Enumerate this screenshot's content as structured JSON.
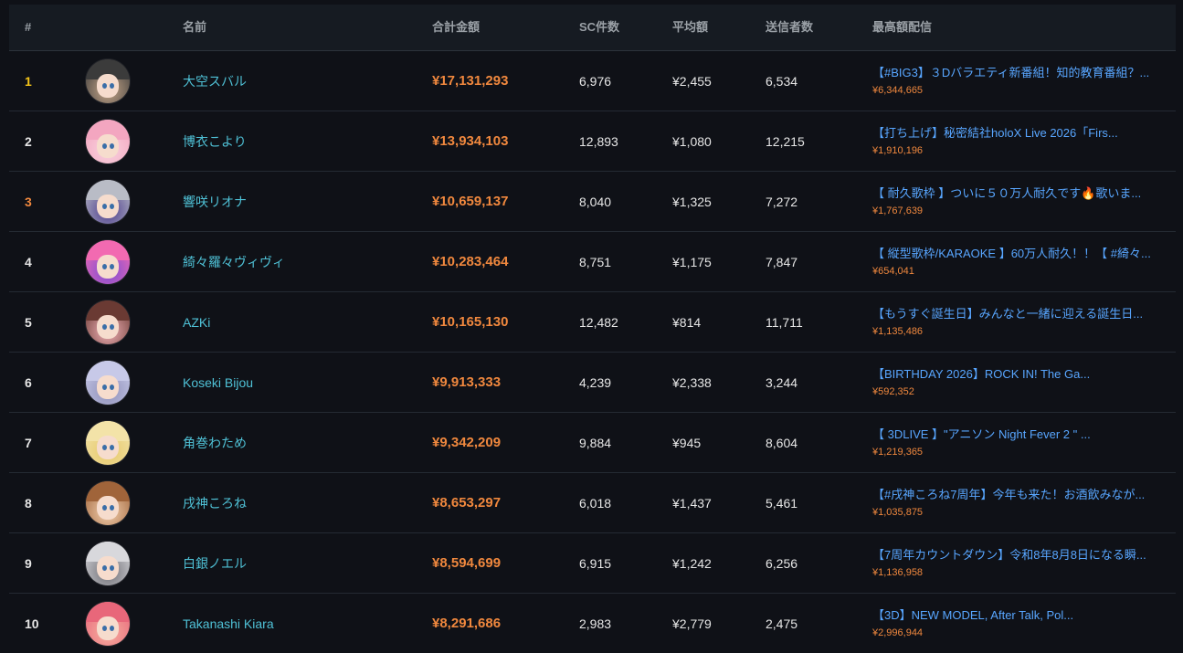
{
  "headers": {
    "rank": "#",
    "avatar": "",
    "name": "名前",
    "total": "合計金額",
    "count": "SC件数",
    "average": "平均額",
    "senders": "送信者数",
    "top_stream": "最高額配信"
  },
  "rows": [
    {
      "rank": "1",
      "name": "大空スバル",
      "total": "¥17,131,293",
      "count": "6,976",
      "average": "¥2,455",
      "senders": "6,534",
      "top_title": "【#BIG3】３Dバラエティ新番組！知的教育番組？...",
      "top_amount": "¥6,344,665",
      "avatar_colors": [
        "#3b3b3b",
        "#c9a98b"
      ]
    },
    {
      "rank": "2",
      "name": "博衣こより",
      "total": "¥13,934,103",
      "count": "12,893",
      "average": "¥1,080",
      "senders": "12,215",
      "top_title": "【打ち上げ】秘密結社holoX Live 2026「Firs...",
      "top_amount": "¥1,910,196",
      "avatar_colors": [
        "#f3a6c0",
        "#f8d2de"
      ]
    },
    {
      "rank": "3",
      "name": "響咲リオナ",
      "total": "¥10,659,137",
      "count": "8,040",
      "average": "¥1,325",
      "senders": "7,272",
      "top_title": "【 耐久歌枠 】ついに５０万人耐久です🔥歌いま...",
      "top_amount": "¥1,767,639",
      "avatar_colors": [
        "#b9bcc6",
        "#4a3a8c"
      ]
    },
    {
      "rank": "4",
      "name": "綺々羅々ヴィヴィ",
      "total": "¥10,283,464",
      "count": "8,751",
      "average": "¥1,175",
      "senders": "7,847",
      "top_title": "【 縦型歌枠/KARAOKE 】60万人耐久！！【 #綺々...",
      "top_amount": "¥654,041",
      "avatar_colors": [
        "#f26ab1",
        "#7a4bd6"
      ]
    },
    {
      "rank": "5",
      "name": "AZKi",
      "total": "¥10,165,130",
      "count": "12,482",
      "average": "¥814",
      "senders": "11,711",
      "top_title": "【もうすぐ誕生日】みんなと一緒に迎える誕生日...",
      "top_amount": "¥1,135,486",
      "avatar_colors": [
        "#6a3a33",
        "#f2b3b9"
      ]
    },
    {
      "rank": "6",
      "name": "Koseki Bijou",
      "total": "¥9,913,333",
      "count": "4,239",
      "average": "¥2,338",
      "senders": "3,244",
      "top_title": "【BIRTHDAY 2026】ROCK IN! The Ga...",
      "top_amount": "¥592,352",
      "avatar_colors": [
        "#c7c9e8",
        "#8e8fb8"
      ]
    },
    {
      "rank": "7",
      "name": "角巻わため",
      "total": "¥9,342,209",
      "count": "9,884",
      "average": "¥945",
      "senders": "8,604",
      "top_title": "【 3DLIVE 】\"アニソン Night Fever 2 \" ...",
      "top_amount": "¥1,219,365",
      "avatar_colors": [
        "#f3e3a8",
        "#e6c86a"
      ]
    },
    {
      "rank": "8",
      "name": "戌神ころね",
      "total": "¥8,653,297",
      "count": "6,018",
      "average": "¥1,437",
      "senders": "5,461",
      "top_title": "【#戌神ころね7周年】今年も来た！お酒飲みなが...",
      "top_amount": "¥1,035,875",
      "avatar_colors": [
        "#a0643a",
        "#f3d1b0"
      ]
    },
    {
      "rank": "9",
      "name": "白銀ノエル",
      "total": "¥8,594,699",
      "count": "6,915",
      "average": "¥1,242",
      "senders": "6,256",
      "top_title": "【7周年カウントダウン】令和8年8月8日になる瞬...",
      "top_amount": "¥1,136,958",
      "avatar_colors": [
        "#d8d8dc",
        "#6d6d74"
      ]
    },
    {
      "rank": "10",
      "name": "Takanashi Kiara",
      "total": "¥8,291,686",
      "count": "2,983",
      "average": "¥2,779",
      "senders": "2,475",
      "top_title": "【3D】NEW MODEL, After Talk, Pol...",
      "top_amount": "¥2,996,944",
      "avatar_colors": [
        "#e8677a",
        "#f6b0a0"
      ]
    }
  ]
}
